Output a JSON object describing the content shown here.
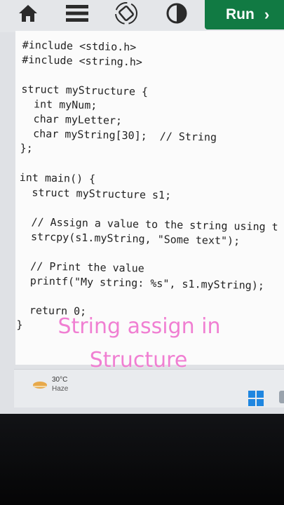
{
  "toolbar": {
    "icons": [
      "home-icon",
      "menu-icon",
      "rotate-icon",
      "contrast-icon"
    ],
    "run_label": "Run",
    "run_arrow": "›",
    "run_color": "#117a43"
  },
  "editor": {
    "code_lines": [
      "#include <stdio.h>",
      "#include <string.h>",
      "",
      "struct myStructure {",
      "  int myNum;",
      "  char myLetter;",
      "  char myString[30];  // String",
      "};",
      "",
      "int main() {",
      "  struct myStructure s1;",
      "",
      "  // Assign a value to the string using t",
      "  strcpy(s1.myString, \"Some text\");",
      "",
      "  // Print the value",
      "  printf(\"My string: %s\", s1.myString);",
      "",
      "  return 0;",
      "}"
    ]
  },
  "caption": {
    "line1": "String assign in",
    "line2": "Structure",
    "color": "#f07fd2"
  },
  "taskbar": {
    "weather_temp": "30°C",
    "weather_condition": "Haze",
    "start_icon": "windows-start-icon"
  }
}
